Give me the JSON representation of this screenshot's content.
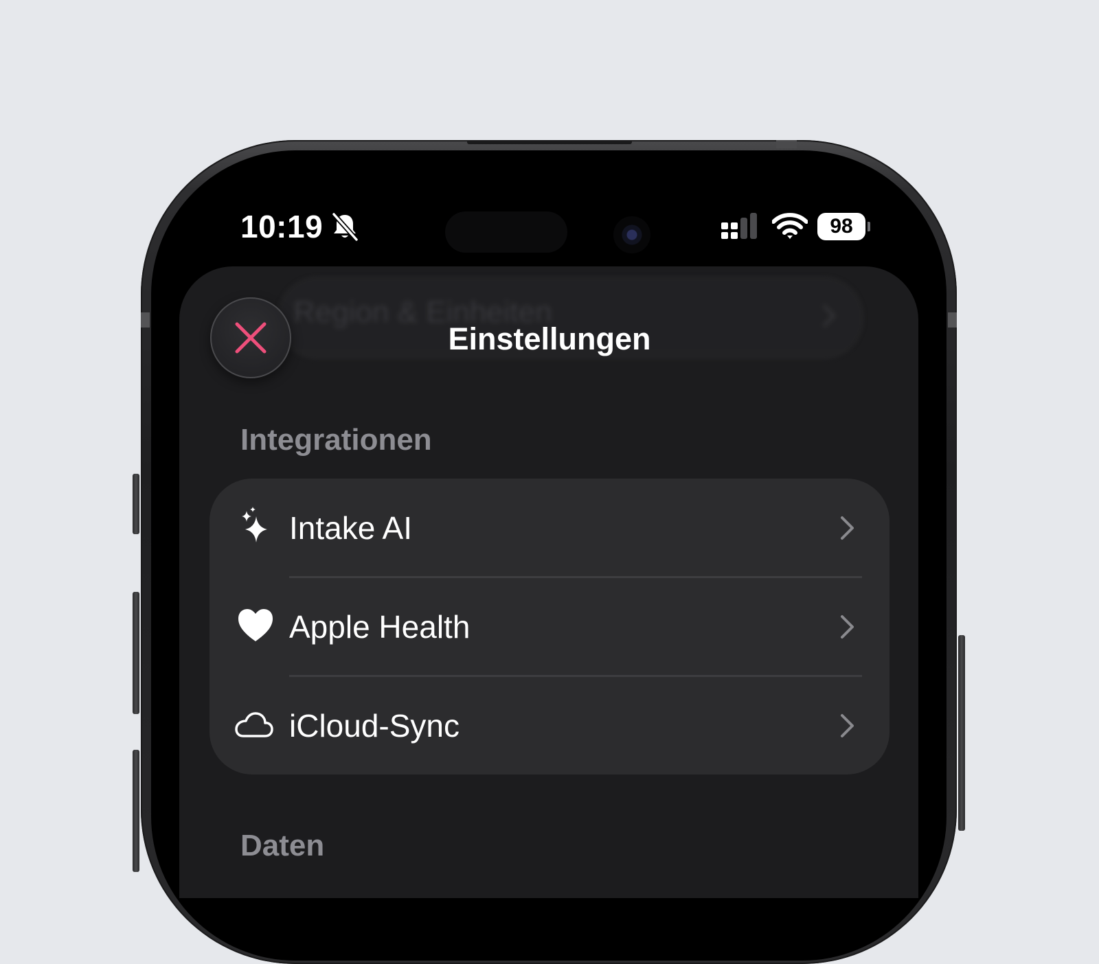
{
  "status_bar": {
    "time": "10:19",
    "battery_level": "98",
    "icons": [
      "bell-slash-icon",
      "cellular-signal-icon",
      "wifi-icon",
      "battery-icon"
    ]
  },
  "sheet": {
    "title": "Einstellungen",
    "close_icon": "close-icon",
    "background_row_label": "Region & Einheiten"
  },
  "sections": [
    {
      "header": "Integrationen",
      "items": [
        {
          "label": "Intake AI",
          "icon": "sparkles-icon"
        },
        {
          "label": "Apple Health",
          "icon": "heart-icon"
        },
        {
          "label": "iCloud-Sync",
          "icon": "cloud-icon"
        }
      ]
    },
    {
      "header": "Daten",
      "items": []
    }
  ],
  "colors": {
    "page_background": "#e6e8ec",
    "screen_background": "#000000",
    "sheet_background": "#1c1c1e",
    "group_background": "#2c2c2e",
    "separator": "#3d3d40",
    "section_header": "#8d8d93",
    "chevron": "#8a8a8e",
    "close_accent": "#ee4f7b",
    "text_primary": "#ffffff"
  }
}
